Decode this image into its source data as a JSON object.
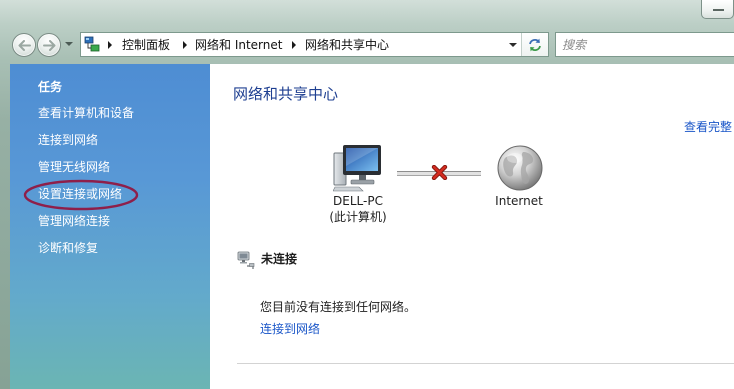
{
  "colors": {
    "title": "#1e3f91",
    "link": "#1a56c8",
    "annotation": "#8e1f4a",
    "disconnected": "#d42b1f"
  },
  "icons": {
    "minimize": "minimize-icon",
    "back": "back-arrow-icon",
    "forward": "forward-arrow-icon",
    "recent": "chevron-down-icon",
    "location": "network-icon",
    "refresh": "refresh-icon",
    "computer": "computer-icon",
    "internet": "globe-icon",
    "connection": "disconnected-x-icon",
    "status": "network-status-icon"
  },
  "address": {
    "crumbs": [
      "控制面板",
      "网络和 Internet",
      "网络和共享中心"
    ]
  },
  "search": {
    "placeholder": "搜索"
  },
  "tasks": {
    "heading": "任务",
    "items": [
      "查看计算机和设备",
      "连接到网络",
      "管理无线网络",
      "设置连接或网络",
      "管理网络连接",
      "诊断和修复"
    ]
  },
  "main": {
    "title": "网络和共享中心",
    "full_map_link": "查看完整",
    "computer": {
      "name": "DELL-PC",
      "caption": "(此计算机)"
    },
    "internet": {
      "label": "Internet"
    },
    "status": {
      "heading": "未连接",
      "message": "您目前没有连接到任何网络。",
      "connect_link": "连接到网络"
    }
  }
}
